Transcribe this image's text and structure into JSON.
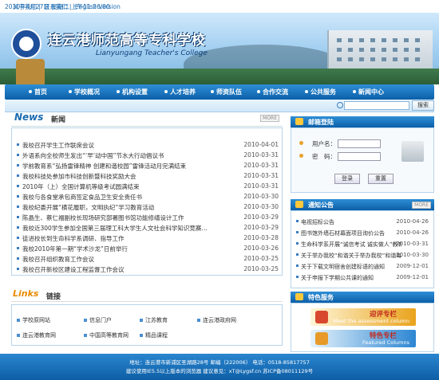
{
  "top": {
    "datetime": "2010年4月27日 星期二 上午11:26:00",
    "links": [
      "关于我们",
      "联系我们",
      "English Version"
    ]
  },
  "banner": {
    "title": "连云港师范高等专科学校",
    "subtitle": "Lianyungang Teacher's College"
  },
  "nav": [
    "首页",
    "学校概况",
    "机构设置",
    "人才培养",
    "师资队伍",
    "合作交流",
    "公共服务",
    "新闻中心"
  ],
  "search": {
    "button": "搜索",
    "value": ""
  },
  "news": {
    "title_en": "News",
    "title_cn": "新闻",
    "more": "MORE",
    "items": [
      {
        "t": "我校召开学生工作联席会议",
        "d": "2010-04-01"
      },
      {
        "t": "外语系向全校师生发出“‘早’动中国”节水大行动倡议书",
        "d": "2010-03-31"
      },
      {
        "t": "学前教育系“弘扬雷锋精神 创建和谐校园”雷锋活动月完满结束",
        "d": "2010-03-31"
      },
      {
        "t": "我校科技处参加市科技创新暨科技奖励大会",
        "d": "2010-03-31"
      },
      {
        "t": "2010年（上）全国计算机等级考试圆满结束",
        "d": "2010-03-31"
      },
      {
        "t": "我校与各食堂承包商签定食品卫生安全责任书",
        "d": "2010-03-30"
      },
      {
        "t": "我校纪委开展“横花履职，文明执纪”学习教育活动",
        "d": "2010-03-30"
      },
      {
        "t": "陈晶生、蔡仁福副校长现场研究部署图书馆功能修缮设计工作",
        "d": "2010-03-29"
      },
      {
        "t": "我校近300学生参加全国第三届理工科大学生人文社会科学知识竞赛…",
        "d": "2010-03-29"
      },
      {
        "t": "徒进校长到生命科学系调研、指导工作",
        "d": "2010-03-28"
      },
      {
        "t": "我校2010年第一期“学术沙龙”日前举行",
        "d": "2010-03-26"
      },
      {
        "t": "我校召开组织教育工作会议",
        "d": "2010-03-25"
      },
      {
        "t": "我校召开新校区建设工程监督工作会议",
        "d": "2010-03-25"
      }
    ]
  },
  "links": {
    "title_en": "Links",
    "title_cn": "链接",
    "items": [
      "学校原网站",
      "信息门户",
      "江苏教育",
      "连云港政府网",
      "连云港教育网",
      "中国高等教育网",
      "精品课程"
    ]
  },
  "login": {
    "title": "邮箱登陆",
    "user_label": "用户名：",
    "pass_label": "密　码：",
    "login_btn": "登录",
    "reset_btn": "重置"
  },
  "notice": {
    "title": "通知公告",
    "more": "MORE",
    "items": [
      {
        "t": "电视招标公告",
        "d": "2010-04-26"
      },
      {
        "t": "图书馆外墙石材幕面项目询价公告",
        "d": "2010-04-26"
      },
      {
        "t": "生命科学系开展“诚信考试 诚实做人”教育活动",
        "d": "2010-03-31"
      },
      {
        "t": "关于举办我校“和谐关于举办我校”和谐每会”",
        "d": "2010-03-30"
      },
      {
        "t": "关于下载文明宿舍创建标语的通知",
        "d": "2009-12-01"
      },
      {
        "t": "关于申报下学期公共课的通知",
        "d": "2009-12-01"
      }
    ]
  },
  "features": {
    "title": "特色服务",
    "items": [
      {
        "cn": "迎评专栏",
        "en": "Meet the assessment column"
      },
      {
        "cn": "特色专栏",
        "en": "Featured Columns"
      }
    ]
  },
  "footer": {
    "line1": "地址：连云港市新浦区圣湖路28号 邮编（222006） 电话：0518-85817757",
    "line2": "建议使用IE5.5以上版本的浏览器 建议意见：xT@Lygsf.cn 苏ICP备08011129号"
  }
}
